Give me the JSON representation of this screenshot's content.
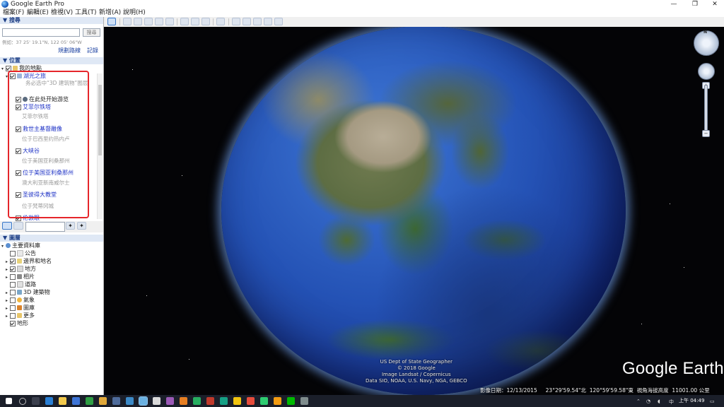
{
  "window": {
    "title": "Google Earth Pro"
  },
  "menu": [
    "檔案(F)",
    "編輯(E)",
    "檢視(V)",
    "工具(T)",
    "新增(A)",
    "說明(H)"
  ],
  "search": {
    "header": "▼ 搜尋",
    "placeholder": "",
    "button": "搜尋",
    "hint": "例如：37 25' 19.1\"N, 122 05' 06\"W",
    "links": [
      "規劃路線",
      "記錄"
    ]
  },
  "places": {
    "header": "▼ 位置",
    "my_places": "我的地點",
    "tour_root": "湖光之旅",
    "tour_note": "务必选中“3D 建筑物”图层",
    "start_here": "在此处开始游览",
    "items": [
      {
        "name": "艾菲尔铁塔",
        "desc": "艾菲尔铁塔"
      },
      {
        "name": "救世主基督雕像",
        "desc": "位于巴西里约热内卢"
      },
      {
        "name": "大峡谷",
        "desc": "位于美国亚利桑那州"
      },
      {
        "name": "位于美国亚利桑那州",
        "desc": "澳大利亚新南威尔士"
      },
      {
        "name": "圣彼得大教堂",
        "desc": "位于梵蒂冈城"
      },
      {
        "name": "伦敦眼",
        "desc": ""
      }
    ]
  },
  "layers": {
    "header": "▼ 圖層",
    "root": "主要資料庫",
    "items": [
      "公告",
      "邊界和地名",
      "地方",
      "相片",
      "道路",
      "3D 建築物",
      "氣象",
      "圖庫",
      "更多",
      "地形"
    ]
  },
  "map": {
    "attribution": [
      "US Dept of State Geographer",
      "© 2018 Google",
      "Image Landsat / Copernicus",
      "Data SIO, NOAA, U.S. Navy, NGA, GEBCO"
    ],
    "brand": "Google Earth",
    "imagery_date_label": "影像日期：",
    "imagery_date": "12/13/2015",
    "lat": "23°29'59.54\"北",
    "lon": "120°59'59.58\"東",
    "eye_alt_label": "視角海拔高度",
    "eye_alt": "11001.00 公里",
    "compass_n": "N"
  },
  "taskbar": {
    "time": "上午 04:49"
  },
  "colors": {
    "red_box": "#e5262b",
    "link_blue": "#1f33c6",
    "sky": "#040406"
  }
}
